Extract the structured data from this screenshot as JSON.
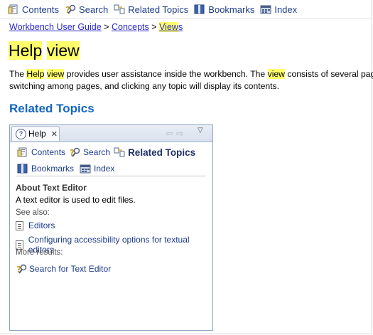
{
  "toolbar": {
    "items": [
      {
        "label": "Contents",
        "icon": "contents-icon"
      },
      {
        "label": "Search",
        "icon": "search-icon"
      },
      {
        "label": "Related Topics",
        "icon": "related-topics-icon"
      },
      {
        "label": "Bookmarks",
        "icon": "bookmarks-icon"
      },
      {
        "label": "Index",
        "icon": "index-icon"
      }
    ]
  },
  "breadcrumb": {
    "items": [
      "Workbench User Guide",
      "Concepts",
      "Views"
    ],
    "separator": ">",
    "current_highlight": "View",
    "current_rest": "s"
  },
  "page": {
    "title_part1": "Help",
    "title_part2": "view",
    "desc1_a": "The ",
    "desc1_hl1": "Help",
    "desc1_b": " ",
    "desc1_hl2": "view",
    "desc1_c": " provides user assistance inside the workbench. The ",
    "desc1_hl3": "view",
    "desc1_d": " consists of several pages.",
    "desc2": "switching among pages, and clicking any topic will display its contents.",
    "related_heading": "Related Topics"
  },
  "help_view": {
    "tab_label": "Help",
    "tab_close": "✕",
    "nav_back": "⇦",
    "nav_forward": "⇨",
    "menu": "▽",
    "row1": {
      "contents": "Contents",
      "search": "Search",
      "related": "Related Topics"
    },
    "row2": {
      "bookmarks": "Bookmarks",
      "index": "Index"
    },
    "about_heading": "About Text Editor",
    "about_text": "A text editor is used to edit files.",
    "see_also": "See also:",
    "links": [
      "Editors",
      "Configuring accessibility options for textual editors"
    ],
    "more_results": "More results:",
    "search_for": "Search for Text Editor"
  },
  "colors": {
    "highlight": "#ffff6a",
    "link": "#2a2ac4",
    "heading_blue": "#1466c0",
    "nav_text": "#1d3b8a"
  }
}
